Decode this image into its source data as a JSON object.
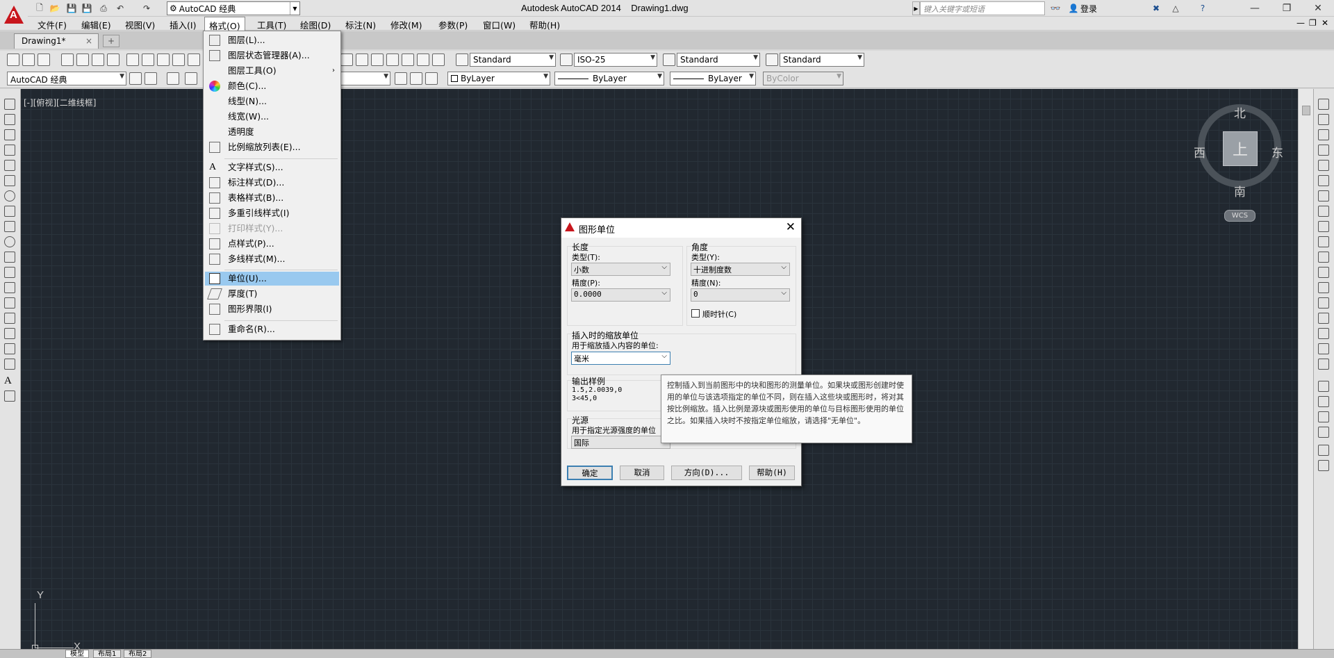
{
  "window": {
    "title": "Autodesk AutoCAD 2014    Drawing1.dwg",
    "workspace": "AutoCAD 经典",
    "search_placeholder": "键入关键字或短语",
    "login": "登录"
  },
  "menubar": {
    "items": [
      "文件(F)",
      "编辑(E)",
      "视图(V)",
      "插入(I)",
      "格式(O)",
      "工具(T)",
      "绘图(D)",
      "标注(N)",
      "修改(M)",
      "参数(P)",
      "窗口(W)",
      "帮助(H)"
    ]
  },
  "doc_tab": {
    "label": "Drawing1*",
    "close": "×"
  },
  "toolbar1": {
    "text_style": "Standard",
    "dim_style": "ISO-25",
    "table_style": "Standard",
    "mleader_style": "Standard"
  },
  "toolbar2": {
    "workspace": "AutoCAD 经典",
    "color": "ByLayer",
    "linetype": "ByLayer",
    "lineweight": "ByLayer",
    "plotstyle": "ByColor"
  },
  "viewport": {
    "label": "[-][俯视][二维线框]",
    "viewcube": {
      "north": "北",
      "south": "南",
      "east": "东",
      "west": "西",
      "top": "上",
      "wcs": "WCS"
    },
    "ucs": {
      "x": "X",
      "y": "Y"
    }
  },
  "format_menu": {
    "items": [
      {
        "label": "图层(L)...",
        "icon": "layer-icon"
      },
      {
        "label": "图层状态管理器(A)...",
        "icon": "layer-state-icon"
      },
      {
        "label": "图层工具(O)",
        "icon": "layer-tools-icon",
        "submenu": "›"
      },
      {
        "label": "颜色(C)...",
        "icon": "color-wheel-icon"
      },
      {
        "label": "线型(N)...",
        "icon": ""
      },
      {
        "label": "线宽(W)...",
        "icon": ""
      },
      {
        "label": "透明度",
        "icon": ""
      },
      {
        "label": "比例缩放列表(E)...",
        "icon": "scale-list-icon"
      },
      {
        "label": "文字样式(S)...",
        "icon": "text-style-icon"
      },
      {
        "label": "标注样式(D)...",
        "icon": "dim-style-icon"
      },
      {
        "label": "表格样式(B)...",
        "icon": "table-style-icon"
      },
      {
        "label": "多重引线样式(I)",
        "icon": "mleader-style-icon"
      },
      {
        "label": "打印样式(Y)...",
        "icon": "plot-style-icon",
        "disabled": true
      },
      {
        "label": "点样式(P)...",
        "icon": "point-style-icon"
      },
      {
        "label": "多线样式(M)...",
        "icon": "mline-style-icon"
      },
      {
        "label": "单位(U)...",
        "icon": "units-icon",
        "highlighted": true
      },
      {
        "label": "厚度(T)",
        "icon": "thickness-icon"
      },
      {
        "label": "图形界限(I)",
        "icon": "limits-icon"
      },
      {
        "label": "重命名(R)...",
        "icon": "rename-icon"
      }
    ]
  },
  "units_dialog": {
    "title": "图形单位",
    "length": {
      "group": "长度",
      "type_label": "类型(T):",
      "type_value": "小数",
      "precision_label": "精度(P):",
      "precision_value": "0.0000"
    },
    "angle": {
      "group": "角度",
      "type_label": "类型(Y):",
      "type_value": "十进制度数",
      "precision_label": "精度(N):",
      "precision_value": "0",
      "clockwise_label": "顺时针(C)"
    },
    "insertion": {
      "group": "插入时的缩放单位",
      "desc": "用于缩放插入内容的单位:",
      "value": "毫米"
    },
    "output": {
      "group": "输出样例",
      "line1": "1.5,2.0039,0",
      "line2": "3<45,0"
    },
    "lighting": {
      "group": "光源",
      "desc": "用于指定光源强度的单位",
      "value": "国际"
    },
    "buttons": {
      "ok": "确定",
      "cancel": "取消",
      "direction": "方向(D)...",
      "help": "帮助(H)"
    }
  },
  "tooltip": {
    "text": "控制插入到当前图形中的块和图形的测量单位。如果块或图形创建时使用的单位与该选项指定的单位不同，则在插入这些块或图形时，将对其按比例缩放。插入比例是源块或图形使用的单位与目标图形使用的单位之比。如果插入块时不按指定单位缩放，请选择\"无单位\"。"
  },
  "statusbar": {
    "tabs": [
      "模型",
      "布局1",
      "布局2"
    ]
  }
}
